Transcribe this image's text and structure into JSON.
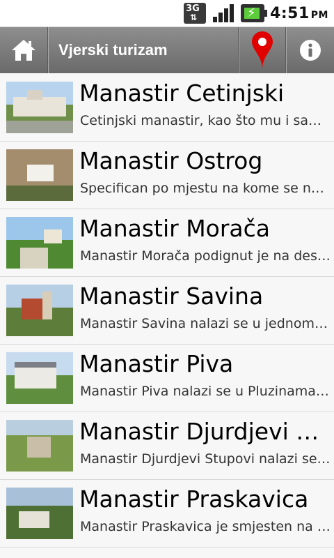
{
  "status_bar": {
    "network_label": "3G",
    "time": "4:51",
    "ampm": "PM",
    "icons": [
      "network-3g-icon",
      "signal-strength-icon",
      "battery-charging-icon"
    ]
  },
  "action_bar": {
    "title": "Vjerski turizam",
    "home_icon": "home-icon",
    "map_icon": "map-pin-icon",
    "info_icon": "info-icon",
    "accent_color": "#e00000"
  },
  "monasteries": [
    {
      "title": "Manastir Cetinjski",
      "description": "Cetinjski manastir, kao što mu i samo ime govori"
    },
    {
      "title": "Manastir Ostrog",
      "description": "Specifican po mjestu na kome se nalazi"
    },
    {
      "title": "Manastir Morača",
      "description": "Manastir Morača podignut je na desnoj obali"
    },
    {
      "title": "Manastir Savina",
      "description": "Manastir Savina nalazi se u jednom od"
    },
    {
      "title": "Manastir Piva",
      "description": "Manastir Piva nalazi se u Pluzinama. Sagrađen"
    },
    {
      "title": "Manastir Djurdjevi Stupovi",
      "description": "Manastir Djurdjevi Stupovi nalazi se na"
    },
    {
      "title": "Manastir Praskavica",
      "description": "Manastir Praskavica je smjesten na brdu"
    }
  ]
}
